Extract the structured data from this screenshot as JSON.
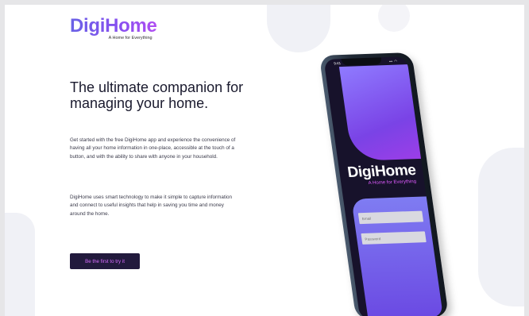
{
  "brand": {
    "name": "DigiHome",
    "tagline": "A Home for Everything"
  },
  "hero": {
    "headline": "The ultimate companion for managing your home.",
    "paragraph_1": "Get started with the free DigiHome app and experience the convenience of having all your home information in one-place, accessible at the touch of a button, and with the ability to share with anyone in your household.",
    "paragraph_2": "DigiHome uses smart technology to make it simple to capture information and connect to useful insights that help in saving you time and money around the home.",
    "cta_label": "Be the first to try it"
  },
  "phone": {
    "status_time": "9:41",
    "status_icons": "▪▪ ◠",
    "app_title": "DigiHome",
    "app_tagline": "A Home for Everything",
    "field_1_placeholder": "Email",
    "field_2_placeholder": "Password"
  },
  "colors": {
    "accent_purple": "#8a4ff0",
    "cta_background": "#221a3d",
    "cta_text": "#d86dff",
    "screen_background": "#17122b"
  }
}
